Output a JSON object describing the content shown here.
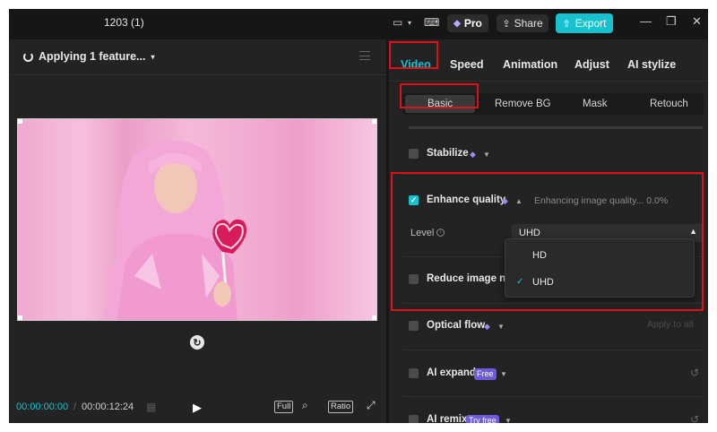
{
  "window": {
    "title": "1203 (1)",
    "pro_label": "Pro",
    "share_label": "Share",
    "export_label": "Export"
  },
  "player": {
    "status": "Applying 1 feature...",
    "time_current": "00:00:00:00",
    "time_separator": "/",
    "time_total": "00:00:12:24",
    "full_label": "Full",
    "ratio_label": "Ratio"
  },
  "tabs": [
    "Video",
    "Speed",
    "Animation",
    "Adjust",
    "AI stylize"
  ],
  "subtabs": [
    "Basic",
    "Remove BG",
    "Mask",
    "Retouch"
  ],
  "features": {
    "stabilize": "Stabilize",
    "enhance_quality": "Enhance quality",
    "enhance_status": "Enhancing image quality... 0.0%",
    "level_label": "Level",
    "level_value": "UHD",
    "reduce_noise": "Reduce image noise",
    "optical_flow": "Optical flow",
    "apply_to_all": "Apply to all",
    "ai_expand": "AI expand",
    "ai_expand_badge": "Free",
    "ai_remix": "AI remix",
    "ai_remix_badge": "Try free"
  },
  "level_options": [
    "HD",
    "UHD"
  ],
  "colors": {
    "accent": "#17c2cf",
    "premium": "#9b87f5",
    "highlight": "#e0101a"
  }
}
